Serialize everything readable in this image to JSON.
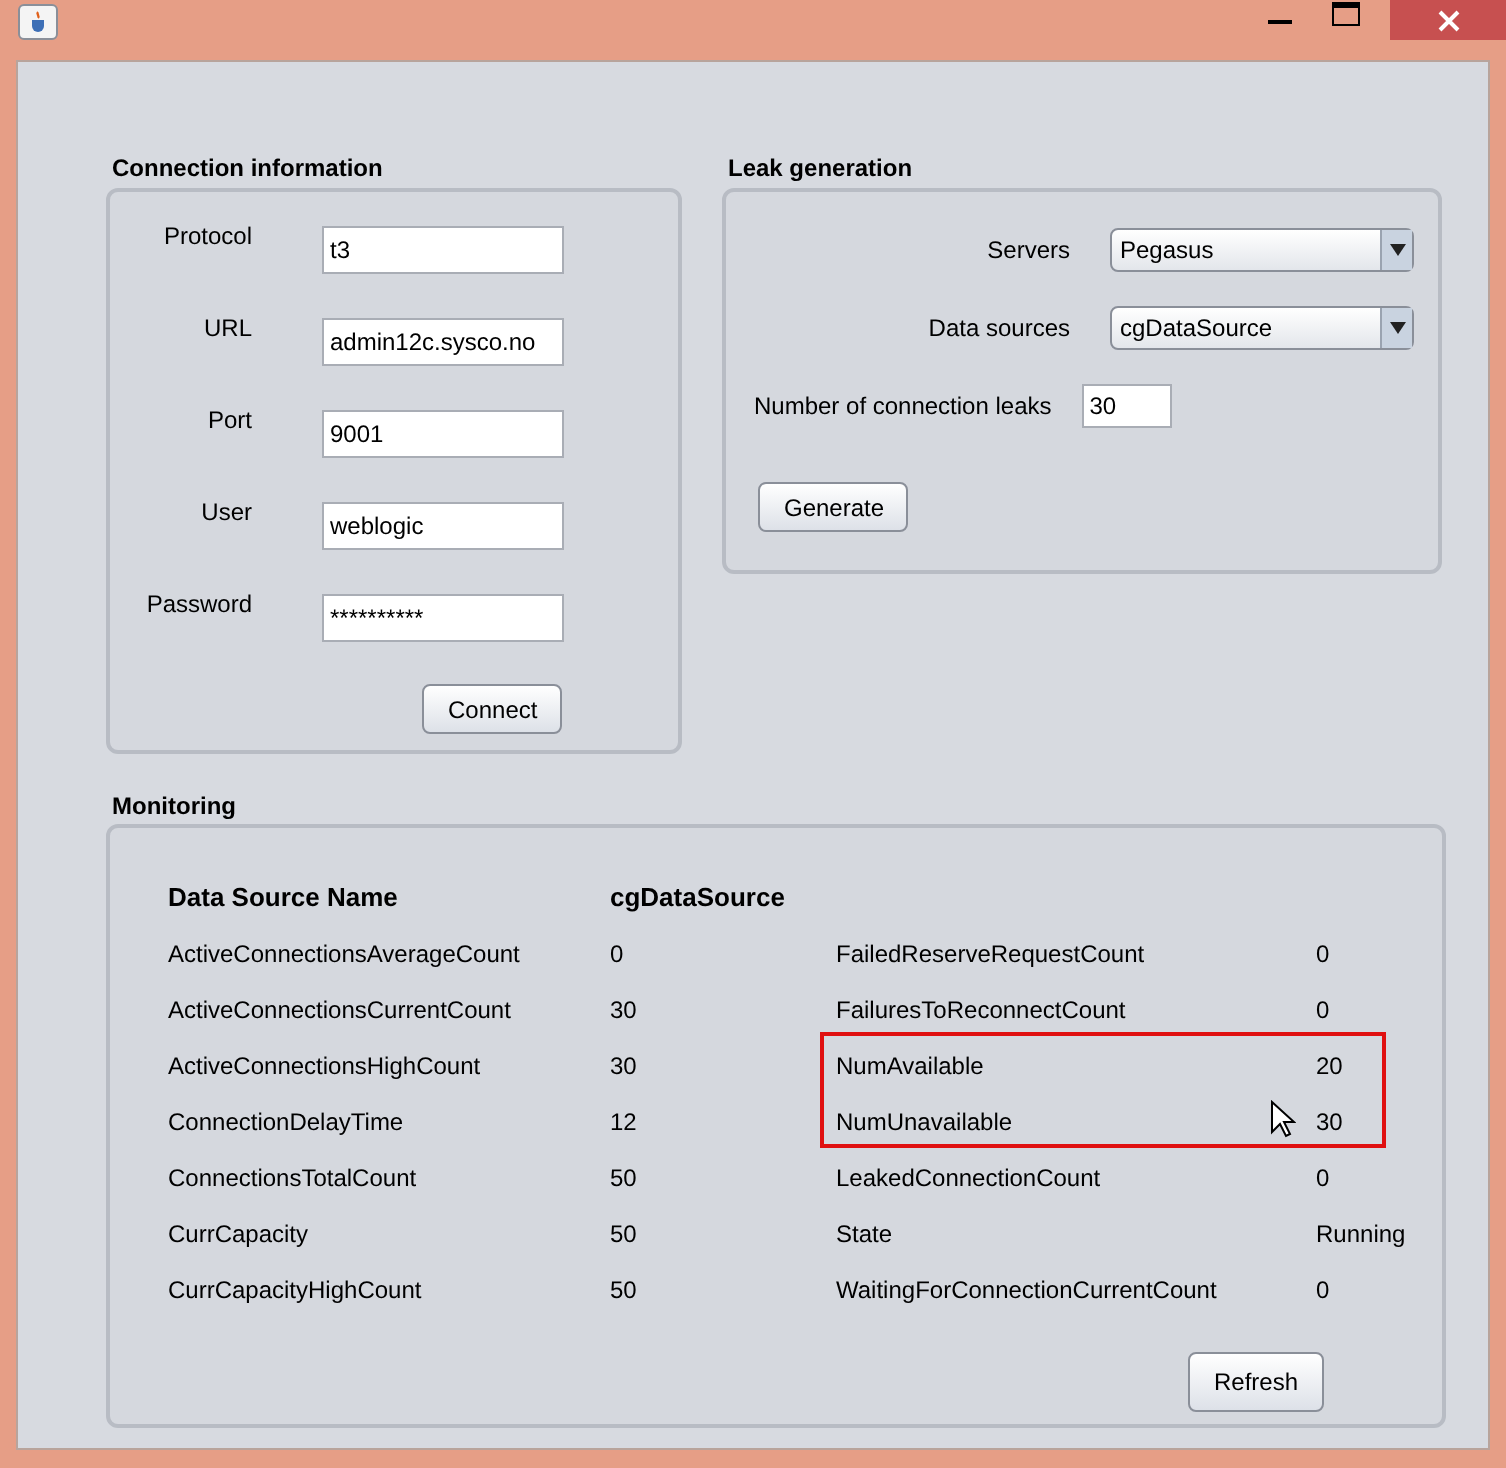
{
  "connection": {
    "title": "Connection information",
    "fields": [
      {
        "label": "Protocol",
        "value": "t3"
      },
      {
        "label": "URL",
        "value": "admin12c.sysco.no"
      },
      {
        "label": "Port",
        "value": "9001"
      },
      {
        "label": "User",
        "value": "weblogic"
      },
      {
        "label": "Password",
        "value": "**********"
      }
    ],
    "connect_button": "Connect"
  },
  "leak": {
    "title": "Leak generation",
    "combos": [
      {
        "label": "Servers",
        "value": "Pegasus"
      },
      {
        "label": "Data sources",
        "value": "cgDataSource"
      }
    ],
    "leaks": {
      "label": "Number of connection leaks",
      "value": "30"
    },
    "generate_button": "Generate"
  },
  "monitoring": {
    "title": "Monitoring",
    "header": {
      "name": "Data Source Name",
      "value": "cgDataSource"
    },
    "rows": [
      {
        "left_name": "ActiveConnectionsAverageCount",
        "left_value": "0",
        "right_name": "FailedReserveRequestCount",
        "right_value": "0",
        "highlighted": false
      },
      {
        "left_name": "ActiveConnectionsCurrentCount",
        "left_value": "30",
        "right_name": "FailuresToReconnectCount",
        "right_value": "0",
        "highlighted": false
      },
      {
        "left_name": "ActiveConnectionsHighCount",
        "left_value": "30",
        "right_name": "NumAvailable",
        "right_value": "20",
        "highlighted": true
      },
      {
        "left_name": "ConnectionDelayTime",
        "left_value": "12",
        "right_name": "NumUnavailable",
        "right_value": "30",
        "highlighted": true
      },
      {
        "left_name": "ConnectionsTotalCount",
        "left_value": "50",
        "right_name": "LeakedConnectionCount",
        "right_value": "0",
        "highlighted": false
      },
      {
        "left_name": "CurrCapacity",
        "left_value": "50",
        "right_name": "State",
        "right_value": "Running",
        "highlighted": false
      },
      {
        "left_name": "CurrCapacityHighCount",
        "left_value": "50",
        "right_name": "WaitingForConnectionCurrentCount",
        "right_value": "0",
        "highlighted": false
      }
    ],
    "refresh_button": "Refresh"
  }
}
